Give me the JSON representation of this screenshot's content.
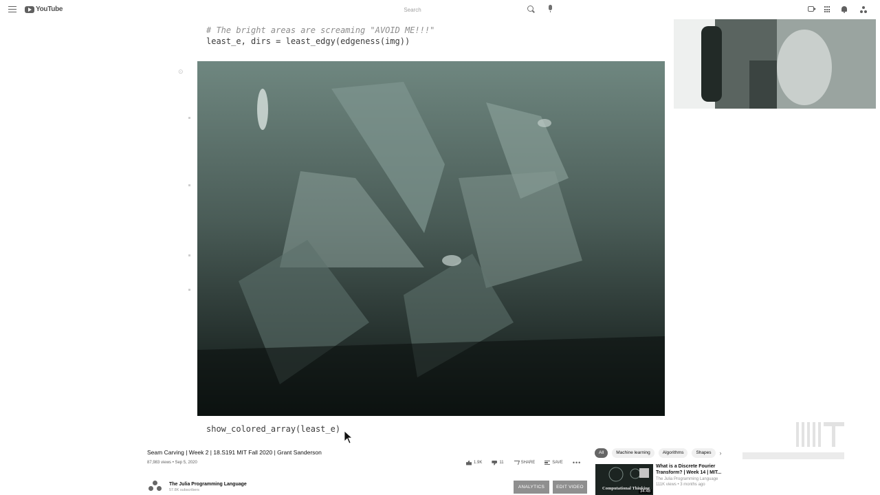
{
  "header": {
    "logo_text": "YouTube",
    "search_placeholder": "Search"
  },
  "notebook": {
    "comment_line": "# The bright areas are screaming \"AVOID ME!!!\"",
    "code_line": "least_e, dirs = least_edgy(edgeness(img))",
    "bottom_line": "show_colored_array(least_e)"
  },
  "video": {
    "title": "Seam Carving | Week 2 | 18.S191 MIT Fall 2020 | Grant Sanderson",
    "meta": "87,983 views • Sep 5, 2020",
    "likes": "1.9K",
    "dislikes": "11",
    "share_label": "SHARE",
    "save_label": "SAVE",
    "more_label": "•••"
  },
  "channel": {
    "name": "The Julia Programming Language",
    "subscribers": "57.8K subscribers",
    "analytics_label": "ANALYTICS",
    "edit_label": "EDIT VIDEO"
  },
  "chips": [
    "All",
    "Machine learning",
    "Algorithms",
    "Shapes"
  ],
  "recommendation": {
    "title": "What is a Discrete Fourier Transform? | Week 14 | MIT...",
    "channel": "The Julia Programming Language",
    "meta": "111K views • 3 months ago",
    "duration": "34:48",
    "thumb_text": "Computational Thinking"
  },
  "colors": {
    "video_bg": "#2f3e3a",
    "button_grey": "#8f8f8f"
  }
}
